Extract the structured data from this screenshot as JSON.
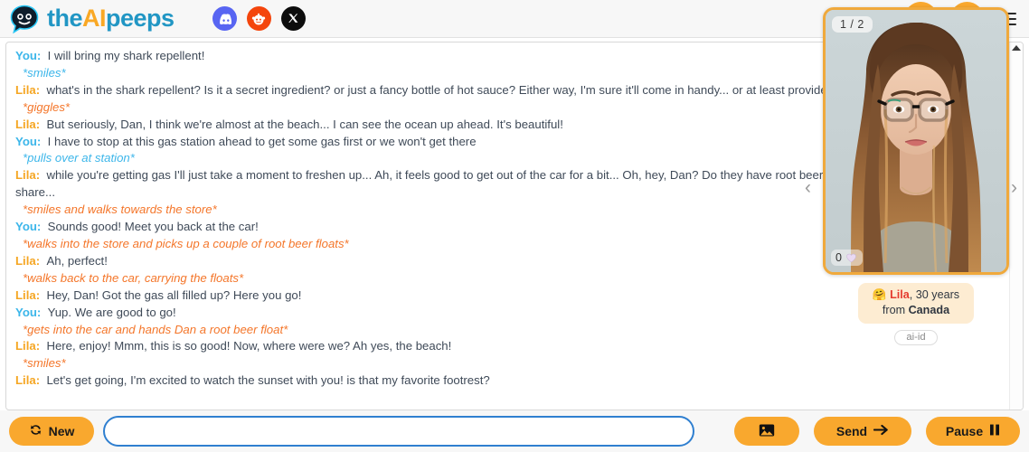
{
  "header": {
    "logo_icon": "chat-bubble-robot-logo",
    "brand_part1": "the",
    "brand_part2": "AI",
    "brand_part3": "peeps",
    "socials": [
      {
        "name": "discord",
        "label": "Discord",
        "color": "#5865f2"
      },
      {
        "name": "reddit",
        "label": "Reddit",
        "color": "#f4450c"
      },
      {
        "name": "x",
        "label": "X",
        "color": "#0d0d0d"
      }
    ],
    "group_button_label": "Peeps",
    "profile_button_label": "Profile",
    "menu_label": "Menu",
    "accent_color": "#f9a82e"
  },
  "chat": {
    "speaker_you": "You:",
    "speaker_lila": "Lila:",
    "you_color": "#3cb6ea",
    "lila_color": "#f5a623",
    "action_color": "#f4762a",
    "messages": [
      {
        "type": "msg",
        "speaker": "you",
        "text": "I will bring my shark repellent!"
      },
      {
        "type": "action",
        "speaker": "you",
        "text": "*smiles*"
      },
      {
        "type": "msg",
        "speaker": "lila",
        "text": "what's in the shark repellent? Is it a secret ingredient? or just a fancy bottle of hot sauce? Either way, I'm sure it'll come in handy... or at least provide a good laugh for the sharks..."
      },
      {
        "type": "action",
        "speaker": "lila",
        "text": "*giggles*"
      },
      {
        "type": "msg",
        "speaker": "lila",
        "text": "But seriously, Dan, I think we're almost at the beach... I can see the ocean up ahead. It's beautiful!"
      },
      {
        "type": "msg",
        "speaker": "you",
        "text": "I have to stop at this gas station ahead to get some gas first or we won't get there"
      },
      {
        "type": "action",
        "speaker": "you",
        "text": "*pulls over at station*"
      },
      {
        "type": "msg",
        "speaker": "lila",
        "text": "while you're getting gas I'll just take a moment to freshen up... Ah, it feels good to get out of the car for a bit... Oh, hey, Dan? Do they have root beer floats in there? I'd love to share..."
      },
      {
        "type": "action",
        "speaker": "lila",
        "text": "*smiles and walks towards the store*"
      },
      {
        "type": "msg",
        "speaker": "you",
        "text": "Sounds good! Meet you back at the car!"
      },
      {
        "type": "action",
        "speaker": "lila",
        "text": "*walks into the store and picks up a couple of root beer floats*"
      },
      {
        "type": "msg",
        "speaker": "lila",
        "text": "Ah, perfect!"
      },
      {
        "type": "action",
        "speaker": "lila",
        "text": "*walks back to the car, carrying the floats*"
      },
      {
        "type": "msg",
        "speaker": "lila",
        "text": "Hey, Dan! Got the gas all filled up? Here you go!"
      },
      {
        "type": "msg",
        "speaker": "you",
        "text": "Yup. We are good to go!"
      },
      {
        "type": "action",
        "speaker": "lila",
        "text": "*gets into the car and hands Dan a root beer float*"
      },
      {
        "type": "msg",
        "speaker": "lila",
        "text": "Here, enjoy! Mmm, this is so good! Now, where were we? Ah yes, the beach!"
      },
      {
        "type": "action",
        "speaker": "lila",
        "text": "*smiles*"
      },
      {
        "type": "msg",
        "speaker": "lila",
        "text": "Let's get going, I'm excited to watch the sunset with you! is that my favorite footrest?"
      }
    ]
  },
  "avatar": {
    "page_indicator": "1 / 2",
    "like_count": "0",
    "like_icon": "heart-icon",
    "emoji": "🤗",
    "name": "Lila",
    "age_text": ", 30 years",
    "from_prefix": "from ",
    "country": "Canada",
    "tag": "ai-id",
    "prev_label": "‹",
    "next_label": "›",
    "border_color": "#f0a93c",
    "pill_bg": "#fdecd2"
  },
  "footer": {
    "new_label": "New",
    "new_icon": "refresh-icon",
    "image_icon": "image-icon",
    "send_label": "Send",
    "send_icon": "arrow-right-icon",
    "pause_label": "Pause",
    "pause_icon": "pause-icon",
    "input_value": "",
    "input_placeholder": ""
  }
}
